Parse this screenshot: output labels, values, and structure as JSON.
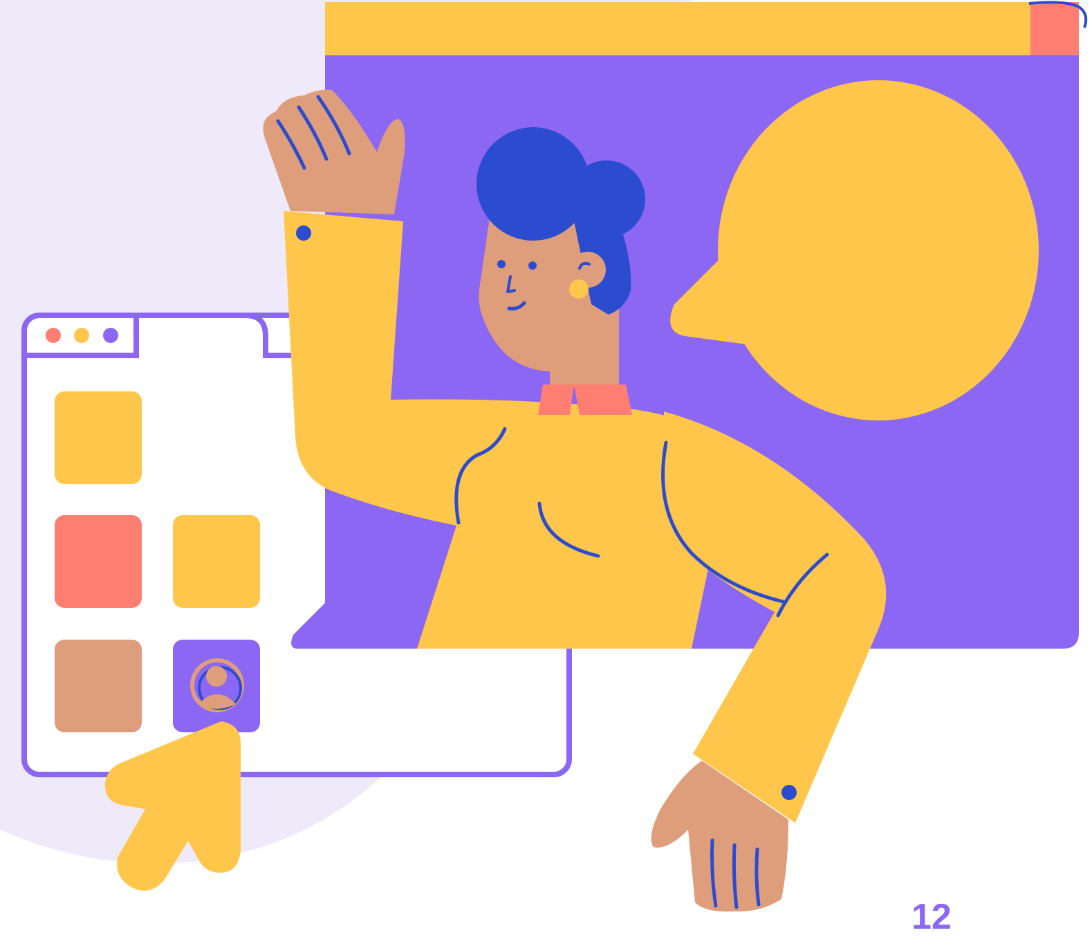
{
  "footer": {
    "page_number": "12"
  },
  "colors": {
    "backdrop": "#efeafa",
    "accent_purple": "#8b67f3",
    "yellow": "#fec64b",
    "coral": "#fe7e72",
    "skin": "#df9e7b",
    "hair_blue": "#2b4ccf",
    "white": "#ffffff"
  },
  "icons": {
    "window_dots": [
      "coral-dot",
      "yellow-dot",
      "purple-dot"
    ],
    "profile": "user-avatar-icon",
    "pointer": "arrow-cursor-icon",
    "chat": "speech-bubble-icon"
  }
}
